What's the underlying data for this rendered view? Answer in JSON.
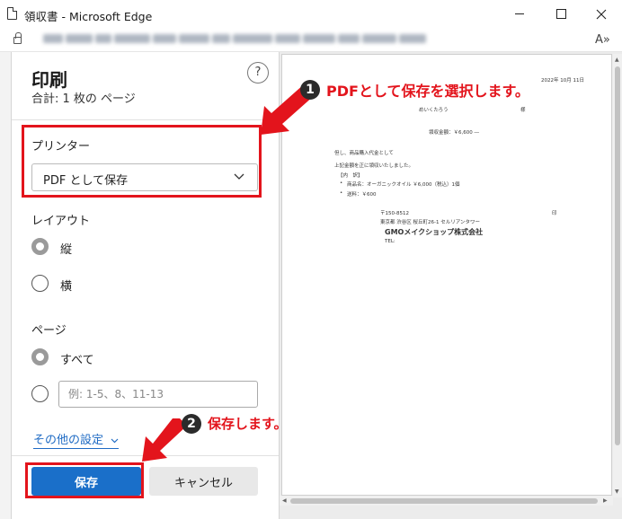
{
  "window": {
    "title": "領収書 - Microsoft Edge",
    "read_aloud_label": "A»"
  },
  "print_panel": {
    "title": "印刷",
    "subtitle": "合計: 1 枚の ページ",
    "help_label": "?",
    "printer": {
      "label": "プリンター",
      "selected": "PDF として保存"
    },
    "layout": {
      "label": "レイアウト",
      "options": [
        {
          "label": "縦",
          "checked": true
        },
        {
          "label": "横",
          "checked": false
        }
      ]
    },
    "pages": {
      "label": "ページ",
      "all_label": "すべて",
      "all_checked": true,
      "range_placeholder": "例: 1-5、8、11-13"
    },
    "more_settings_label": "その他の設定",
    "save_label": "保存",
    "cancel_label": "キャンセル"
  },
  "preview": {
    "date": "2022年 10月 11日",
    "recipient": "めいくたろう",
    "honorific": "様",
    "amount_line": "領収金額：￥6,600 ―",
    "but_line": "但し、商品購入代金として",
    "received_line": "上記金額を正に領収いたしました。",
    "breakdown_header": "【内　訳】",
    "item_1": "商品名：オーガニックオイル ￥6,000（税込）1個",
    "item_2": "送料：￥600",
    "postal": "〒150-8512",
    "address": "東京都 渋谷区 桜丘町26-1 セルリアンタワー",
    "company": "GMOメイクショップ株式会社",
    "tel": "TEL:",
    "seal": "印"
  },
  "annotations": {
    "step1_number": "1",
    "step1_text": "PDFとして保存を選択します。",
    "step2_number": "2",
    "step2_text": "保存します。",
    "accent_color": "#e3141c"
  }
}
